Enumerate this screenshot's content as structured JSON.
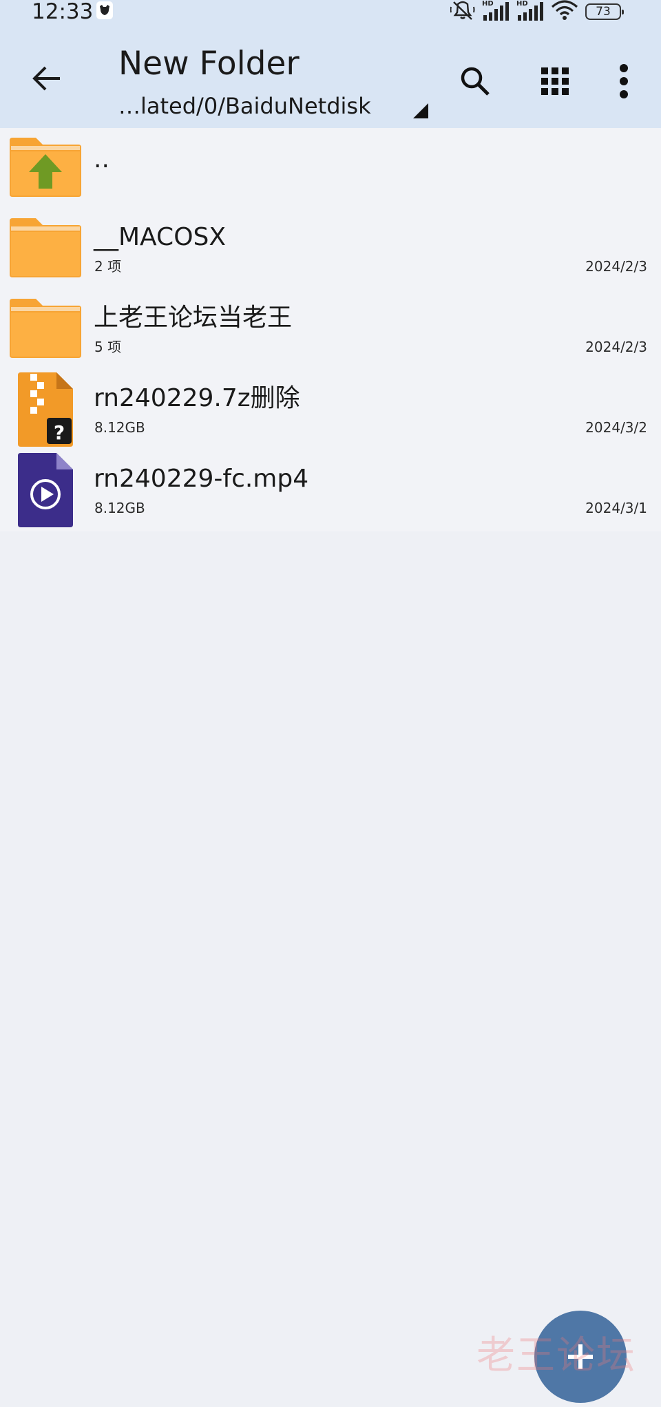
{
  "status_bar": {
    "time": "12:33",
    "network_label": "HD",
    "battery_level": "73",
    "icons": [
      "app-notification-icon",
      "muted-vibrate-icon",
      "signal-icon",
      "signal-icon",
      "wifi-icon",
      "battery-icon"
    ]
  },
  "toolbar": {
    "title": "New Folder",
    "path": "…lated/0/BaiduNetdisk",
    "icons": [
      "back-arrow-icon",
      "dropdown-triangle-icon",
      "search-icon",
      "grid-view-icon",
      "more-vert-icon"
    ]
  },
  "files": [
    {
      "name": "..",
      "meta": "",
      "date": "",
      "icon": "folder-up-icon"
    },
    {
      "name": "__MACOSX",
      "meta": "2 项",
      "date": "2024/2/3",
      "icon": "folder-icon"
    },
    {
      "name": "上老王论坛当老王",
      "meta": "5 项",
      "date": "2024/2/3",
      "icon": "folder-icon"
    },
    {
      "name": "rn240229.7z删除",
      "meta": "8.12GB",
      "date": "2024/3/2",
      "icon": "archive-unknown-icon"
    },
    {
      "name": "rn240229-fc.mp4",
      "meta": "8.12GB",
      "date": "2024/3/1",
      "icon": "video-file-icon"
    }
  ],
  "fab": {
    "icon": "plus-icon"
  },
  "watermark": "老王论坛",
  "colors": {
    "toolbar_bg": "#d9e5f4",
    "list_bg": "#f2f3f7",
    "page_bg": "#eef0f5",
    "folder": "#f7a434",
    "up_arrow": "#6f9a24",
    "archive": "#f29a28",
    "video": "#3c2d8a",
    "fab": "#4f77a6"
  }
}
